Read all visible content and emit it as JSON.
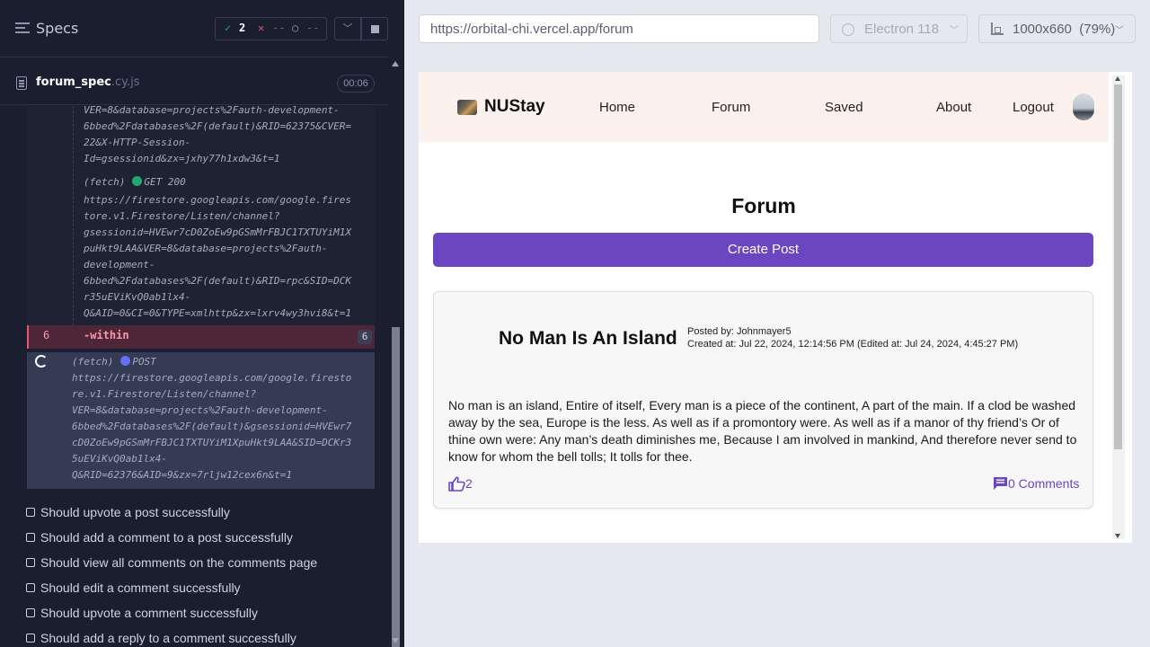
{
  "sidebar": {
    "title": "Specs",
    "stats": {
      "passed": "2",
      "failed": "--",
      "pending": "--"
    },
    "spec_file": {
      "name": "forum_spec",
      "ext": ".cy.js",
      "duration": "00:06"
    }
  },
  "command_log": {
    "first_url_tail": "VER=8&database=projects%2Fauth-development-\n6bbed%2Fdatabases%2F(default)&RID=62375&CVER=\n22&X-HTTP-Session-\nId=gsessionid&zx=jxhy77h1xdw3&t=1",
    "fetch_get": {
      "label": "(fetch)",
      "method": "GET 200"
    },
    "second_url": "https://firestore.googleapis.com/google.fires\ntore.v1.Firestore/Listen/channel?\ngsessionid=HVEwr7cD0ZoEw9pGSmMrFBJC1TXTUYiM1X\npuHkt9LAA&VER=8&database=projects%2Fauth-\ndevelopment-\n6bbed%2Fdatabases%2F(default)&RID=rpc&SID=DCK\nr35uEViKvQ0ab1lx4-\nQ&AID=0&CI=0&TYPE=xmlhttp&zx=lxrv4wy3hvi8&t=1",
    "within": {
      "number": "6",
      "text": "-within",
      "badge": "6"
    },
    "fetch_post": {
      "label": "(fetch)",
      "method": "POST",
      "url": "https://firestore.googleapis.com/google.firesto\nre.v1.Firestore/Listen/channel?\nVER=8&database=projects%2Fauth-development-\n6bbed%2Fdatabases%2F(default)&gsessionid=HVEwr7\ncD0ZoEw9pGSmMrFBJC1TXTUYiM1XpuHkt9LAA&SID=DCKr3\n5uEViKvQ0ab1lx4-\nQ&RID=62376&AID=9&zx=7rljw12cex6n&t=1"
    }
  },
  "tests": [
    "Should upvote a post successfully",
    "Should add a comment to a post successfully",
    "Should view all comments on the comments page",
    "Should edit a comment successfully",
    "Should upvote a comment successfully",
    "Should add a reply to a comment successfully"
  ],
  "runner": {
    "url": "https://orbital-chi.vercel.app/forum",
    "browser": "Electron 118",
    "viewport": "1000x660  (79%)"
  },
  "app": {
    "brand": "NUStay",
    "nav": [
      "Home",
      "Forum",
      "Saved",
      "About",
      "Logout"
    ],
    "page_title": "Forum",
    "create_post_label": "Create Post",
    "post": {
      "title": "No Man Is An Island",
      "posted_by": "Posted by: Johnmayer5",
      "created_at": "Created at: Jul 22, 2024, 12:14:56 PM (Edited at: Jul 24, 2024, 4:45:27 PM)",
      "body": "No man is an island, Entire of itself, Every man is a piece of the continent, A part of the main. If a clod be washed away by the sea, Europe is the less. As well as if a promontory were. As well as if a manor of thy friend’s Or of thine own were: Any man’s death diminishes me, Because I am involved in mankind, And therefore never send to know for whom the bell tolls; It tolls for thee.",
      "upvotes": "2",
      "comments_label": "0 Comments"
    }
  },
  "colors": {
    "cypress_bg": "#1b1e2e",
    "pass": "#1fa971",
    "fail": "#e45770",
    "app_accent": "#6b46c1",
    "navbar_bg": "#fdf1ee"
  },
  "icons": [
    "specs-icon",
    "check-icon",
    "x-icon",
    "pending-icon",
    "chevron-down-icon",
    "stop-icon",
    "file-icon",
    "spinner-icon",
    "electron-icon",
    "viewport-icon",
    "thumbs-up-icon",
    "comment-icon",
    "avatar"
  ]
}
